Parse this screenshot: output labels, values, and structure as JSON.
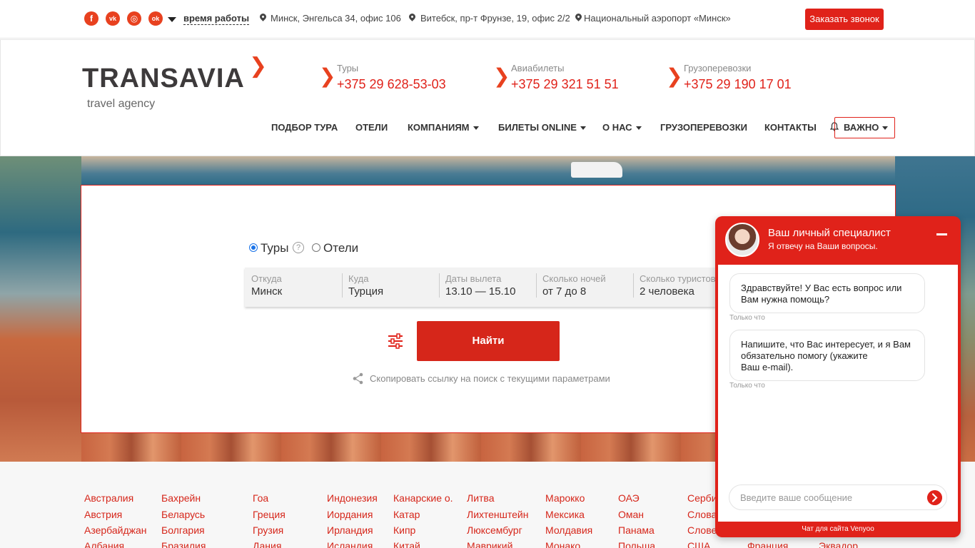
{
  "topbar": {
    "social_icons": [
      "facebook-icon",
      "vk-icon",
      "instagram-icon",
      "odnoklassniki-icon"
    ],
    "social_glyphs": [
      "f",
      "vk",
      "◎",
      "ok"
    ],
    "work_hours": "время работы",
    "addresses": [
      "Минск, Энгельса 34, офис 106",
      "Витебск, пр-т Фрунзе, 19, офис 2/2",
      "Национальный аэропорт «Минск»"
    ],
    "callback_label": "Заказать звонок"
  },
  "header": {
    "logo": "TRANSAVIA",
    "logo_sub": "travel agency",
    "phones": [
      {
        "label": "Туры",
        "number": "+375 29 628-53-03"
      },
      {
        "label": "Авиабилеты",
        "number": "+375 29 321 51 51"
      },
      {
        "label": "Грузоперевозки",
        "number": "+375 29 190 17 01"
      }
    ],
    "nav": [
      "ПОДБОР ТУРА",
      "ОТЕЛИ",
      "КОМПАНИЯМ",
      "БИЛЕТЫ ONLINE",
      "О НАС",
      "ГРУЗОПЕРЕВОЗКИ",
      "КОНТАКТЫ",
      "ВАЖНО"
    ]
  },
  "search": {
    "mode_tours": "Туры",
    "mode_hotels": "Отели",
    "selected_mode": "Туры",
    "help_glyph": "?",
    "fields": [
      {
        "label": "Откуда",
        "value": "Минск"
      },
      {
        "label": "Куда",
        "value": "Турция"
      },
      {
        "label": "Даты вылета",
        "value": "13.10 — 15.10"
      },
      {
        "label": "Сколько ночей",
        "value": "от 7 до 8"
      },
      {
        "label": "Сколько туристов",
        "value": "2 человека"
      }
    ],
    "search_label": "Найти",
    "copy_link": "Скопировать ссылку на поиск с текущими параметрами"
  },
  "countries": [
    [
      "Австралия",
      "Австрия",
      "Азербайджан",
      "Албания"
    ],
    [
      "Бахрейн",
      "Беларусь",
      "Болгария",
      "Бразилия"
    ],
    [
      "Гоа",
      "Греция",
      "Грузия",
      "Дания"
    ],
    [
      "Индонезия",
      "Иордания",
      "Ирландия",
      "Исландия"
    ],
    [
      "Канарские о.",
      "Катар",
      "Кипр",
      "Китай"
    ],
    [
      "Литва",
      "Лихтенштейн",
      "Люксембург",
      "Маврикий"
    ],
    [
      "Марокко",
      "Мексика",
      "Молдавия",
      "Монако"
    ],
    [
      "ОАЭ",
      "Оман",
      "Панама",
      "Польша"
    ],
    [
      "Серби",
      "Словак",
      "Словен",
      "США"
    ],
    [
      "",
      "",
      "",
      "Франция"
    ],
    [
      "",
      "",
      "",
      "Эквадор"
    ]
  ],
  "chat": {
    "title": "Ваш личный специалист",
    "subtitle": "Я отвечу на Ваши вопросы.",
    "messages": [
      {
        "text": "Здравствуйте! У Вас есть вопрос или\nВам нужна помощь?",
        "time": "Только что"
      },
      {
        "text": "Напишите, что Вас интересует, и я Вам\nобязательно помогу (укажите\n Ваш e-mail).",
        "time": "Только что"
      }
    ],
    "input_placeholder": "Введите ваше сообщение",
    "footer": "Чат для сайта Venyoo"
  },
  "colors": {
    "accent": "#e0221a",
    "accent_light": "#e8411f",
    "text": "#333333"
  }
}
